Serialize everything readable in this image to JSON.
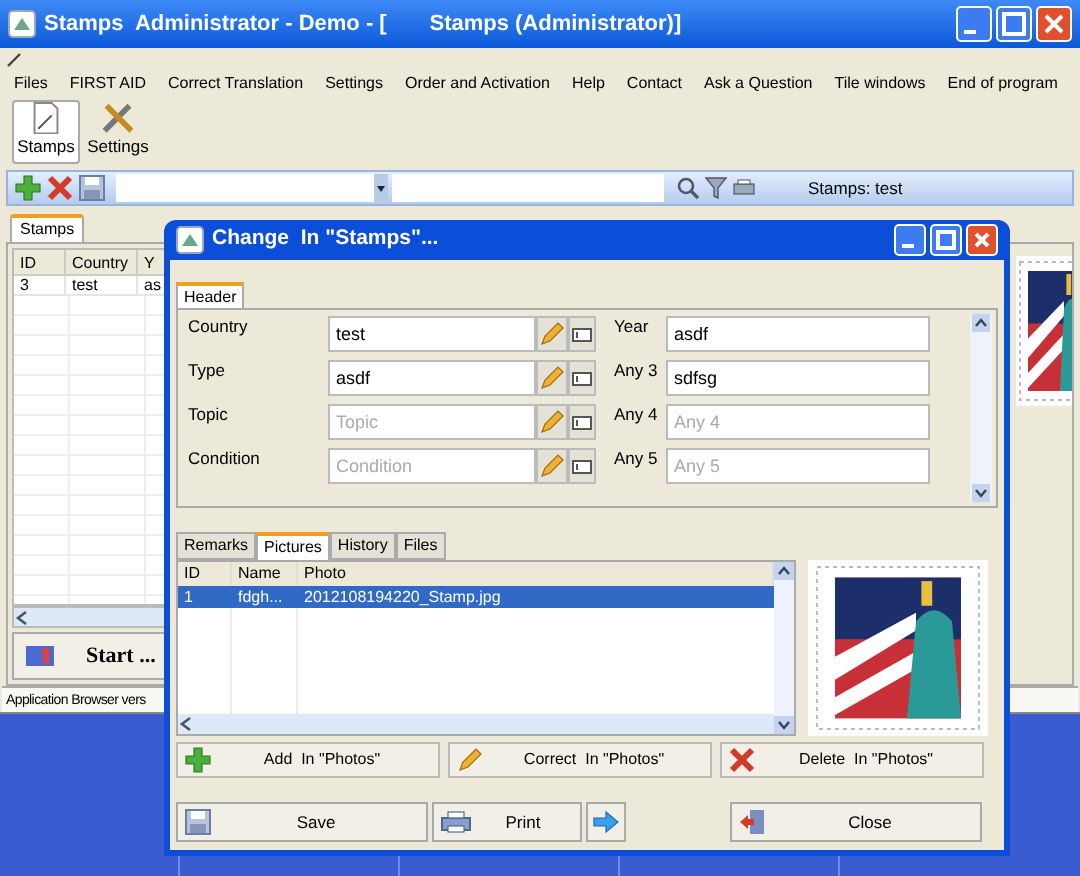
{
  "main_window": {
    "title": "Stamps  Administrator - Demo - [       Stamps (Administrator)]",
    "menu": [
      "Files",
      "FIRST AID",
      "Correct Translation",
      "Settings",
      "Order and Activation",
      "Help",
      "Contact",
      "Ask a Question",
      "Tile windows",
      "End of program"
    ],
    "toolbar": [
      {
        "kind": "stamps",
        "label": "Stamps",
        "selected": true
      },
      {
        "kind": "settings",
        "label": "Settings",
        "selected": false
      }
    ],
    "search_bar": {
      "status": "Stamps: test"
    },
    "tabs": [
      {
        "label": "Stamps",
        "selected": true
      }
    ],
    "table": {
      "columns": [
        "ID",
        "Country",
        "Y"
      ],
      "rows": [
        [
          "3",
          "test",
          "as"
        ]
      ]
    },
    "start_button": "Start ...",
    "status_bar": "Application Browser vers"
  },
  "dialog": {
    "title": "Change  In \"Stamps\"...",
    "header_tab": {
      "label": "Header",
      "selected": true
    },
    "fields_left": [
      {
        "label": "Country",
        "value": "test"
      },
      {
        "label": "Type",
        "value": "asdf"
      },
      {
        "label": "Topic",
        "placeholder": "Topic"
      },
      {
        "label": "Condition",
        "placeholder": "Condition"
      }
    ],
    "fields_right": [
      {
        "label": "Year",
        "value": "asdf"
      },
      {
        "label": "Any 3",
        "value": "sdfsg"
      },
      {
        "label": "Any 4",
        "placeholder": "Any 4"
      },
      {
        "label": "Any 5",
        "placeholder": "Any 5"
      }
    ],
    "tabs": [
      {
        "label": "Remarks",
        "selected": false
      },
      {
        "label": "Pictures",
        "selected": true
      },
      {
        "label": "History",
        "selected": false
      },
      {
        "label": "Files",
        "selected": false
      }
    ],
    "photos_table": {
      "columns": [
        "ID",
        "Name",
        "Photo"
      ],
      "rows": [
        {
          "cells": [
            "1",
            "fdgh...",
            "2012108194220_Stamp.jpg"
          ],
          "selected": true
        }
      ]
    },
    "photo_buttons": [
      {
        "kind": "add",
        "label": "Add  In \"Photos\""
      },
      {
        "kind": "edit",
        "label": "Correct  In \"Photos\""
      },
      {
        "kind": "delete",
        "label": "Delete  In \"Photos\""
      }
    ],
    "buttons": [
      {
        "kind": "save",
        "label": "Save"
      },
      {
        "kind": "print",
        "label": "Print"
      },
      {
        "kind": "next"
      },
      {
        "kind": "close",
        "label": "Close"
      }
    ]
  }
}
